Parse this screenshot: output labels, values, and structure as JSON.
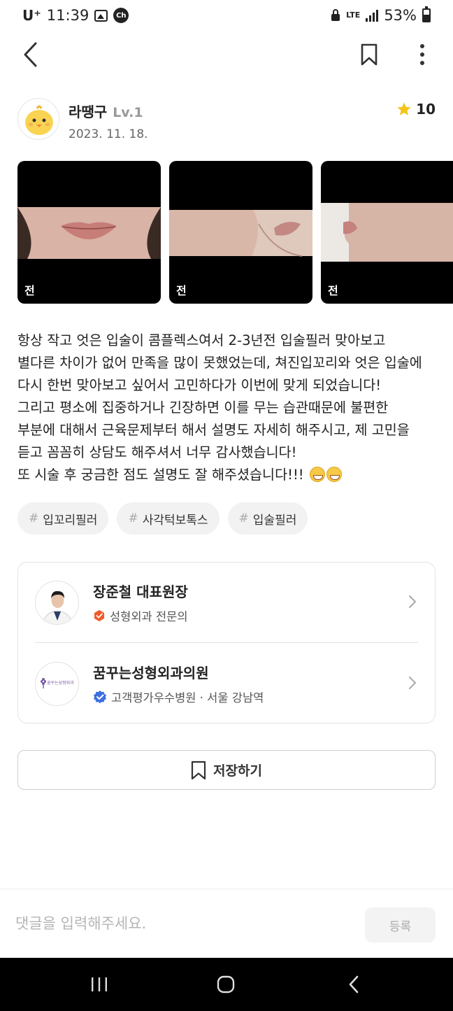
{
  "status_bar": {
    "carrier": "U⁺",
    "time": "11:39",
    "ch_badge": "Ch",
    "network": "LTE",
    "battery": "53%"
  },
  "author": {
    "name": "라땡구",
    "level": "Lv.1",
    "date": "2023. 11. 18.",
    "rating": "10"
  },
  "photos": [
    {
      "label": "전"
    },
    {
      "label": "전"
    },
    {
      "label": "전"
    }
  ],
  "review": {
    "lines": [
      "항상 작고 엇은 입술이 콤플렉스여서 2-3년전 입술필러 맞아보고",
      "별다른 차이가 없어 만족을 많이 못했었는데, 쳐진입꼬리와 엇은 입술에",
      "다시 한번 맞아보고 싶어서 고민하다가 이번에 맞게 되었습니다!",
      "그리고 평소에 집중하거나 긴장하면 이를 무는 습관때문에 불편한",
      "부분에 대해서 근육문제부터 해서 설명도 자세히 해주시고, 제 고민을",
      "듣고 꼼꼼히 상담도 해주셔서 너무 감사했습니다!",
      "또 시술 후 궁금한 점도 설명도 잘 해주셨습니다!!!"
    ]
  },
  "tags": [
    {
      "hash": "#",
      "label": "입꼬리필러"
    },
    {
      "hash": "#",
      "label": "사각턱보톡스"
    },
    {
      "hash": "#",
      "label": "입술필러"
    }
  ],
  "doctor": {
    "name": "장준철 대표원장",
    "specialty": "성형외과 전문의",
    "badge_color": "#f05a28"
  },
  "clinic": {
    "name": "꿈꾸는성형외과의원",
    "info": "고객평가우수병원 · 서울 강남역",
    "logo_text": "꿈꾸는성형외과",
    "badge_color": "#3d6fe0"
  },
  "save_button": {
    "label": "저장하기"
  },
  "comment": {
    "placeholder": "댓글을 입력해주세요.",
    "submit_label": "등록"
  },
  "icons": {
    "back": "back-arrow-icon",
    "bookmark": "bookmark-icon",
    "more": "more-vertical-icon",
    "star": "star-icon",
    "chevron": "chevron-right-icon",
    "verified": "verified-badge-icon"
  },
  "colors": {
    "star": "#f5c518",
    "text_primary": "#222222",
    "text_muted": "#999999"
  }
}
